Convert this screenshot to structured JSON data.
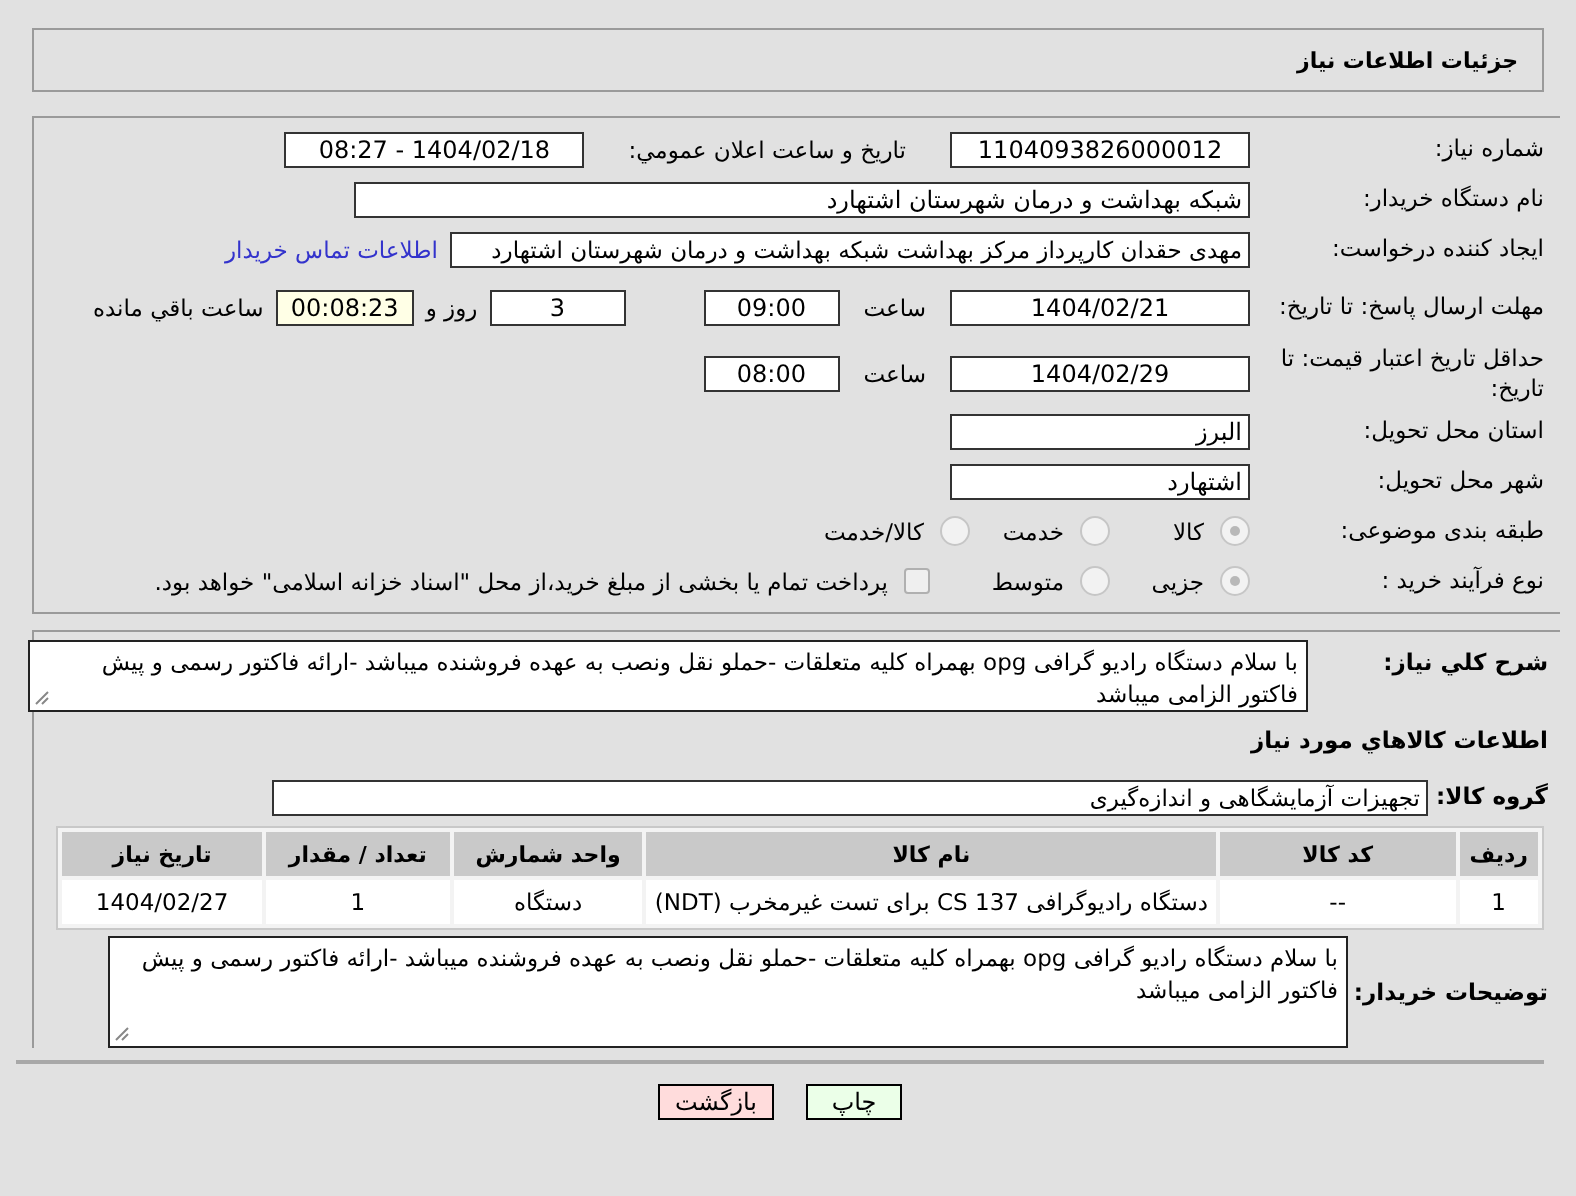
{
  "header": {
    "title": "جزئیات اطلاعات نیاز"
  },
  "need_number": {
    "label": "شماره نیاز:",
    "value": "1104093826000012"
  },
  "announce": {
    "label": "تاریخ و ساعت اعلان عمومي:",
    "value": "1404/02/18 - 08:27"
  },
  "buyer": {
    "label": "نام دستگاه خریدار:",
    "value": "شبکه بهداشت و درمان شهرستان اشتهارد"
  },
  "creator": {
    "label": "ایجاد کننده درخواست:",
    "value": "مهدی حقدان کارپرداز مرکز بهداشت شبکه بهداشت و درمان شهرستان اشتهارد",
    "link": "اطلاعات تماس خریدار"
  },
  "deadline": {
    "label": "مهلت ارسال پاسخ: تا تاریخ:",
    "date": "1404/02/21",
    "time_label": "ساعت",
    "time": "09:00",
    "days": "3",
    "days_label": "روز و",
    "remaining": "00:08:23",
    "remaining_label": "ساعت باقي مانده"
  },
  "validity": {
    "label": "حداقل تاریخ اعتبار قیمت: تا تاریخ:",
    "date": "1404/02/29",
    "time_label": "ساعت",
    "time": "08:00"
  },
  "province": {
    "label": "استان محل تحویل:",
    "value": "البرز"
  },
  "city": {
    "label": "شهر محل تحویل:",
    "value": "اشتهارد"
  },
  "category": {
    "label": "طبقه بندی موضوعی:",
    "options": [
      {
        "label": "کالا",
        "selected": true
      },
      {
        "label": "خدمت",
        "selected": false
      },
      {
        "label": "کالا/خدمت",
        "selected": false
      }
    ]
  },
  "process": {
    "label": "نوع فرآیند خرید :",
    "options": [
      {
        "label": "جزیی",
        "selected": true
      },
      {
        "label": "متوسط",
        "selected": false
      }
    ],
    "treasury": {
      "checked": false,
      "label": "پرداخت تمام یا بخشی از مبلغ خرید،از محل \"اسناد خزانه اسلامی\" خواهد بود."
    }
  },
  "description": {
    "label": "شرح کلي نیاز:",
    "value": "با سلام دستگاه رادیو گرافی opg بهمراه کلیه متعلقات -حملو نقل ونصب به عهده فروشنده میباشد -ارائه فاکتور رسمی و پیش فاکتور الزامی میباشد"
  },
  "goods_heading": "اطلاعات کالاهاي مورد نیاز",
  "goods_group": {
    "label": "گروه کالا:",
    "value": "تجهیزات آزمایشگاهی و اندازه‌گیری"
  },
  "table": {
    "columns": [
      "ردیف",
      "کد کالا",
      "نام کالا",
      "واحد شمارش",
      "تعداد / مقدار",
      "تاریخ نیاز"
    ],
    "rows": [
      [
        "1",
        "--",
        "دستگاه رادیوگرافی CS 137 برای تست غیرمخرب (NDT)",
        "دستگاه",
        "1",
        "1404/02/27"
      ]
    ]
  },
  "buyer_notes": {
    "label": "توضیحات خریدار:",
    "value": "با سلام دستگاه رادیو گرافی opg بهمراه کلیه متعلقات -حملو نقل ونصب به عهده فروشنده میباشد -ارائه فاکتور رسمی و پیش فاکتور الزامی میباشد"
  },
  "buttons": [
    {
      "label": "چاپ",
      "kind": "print"
    },
    {
      "label": "بازگشت",
      "kind": "back"
    }
  ]
}
